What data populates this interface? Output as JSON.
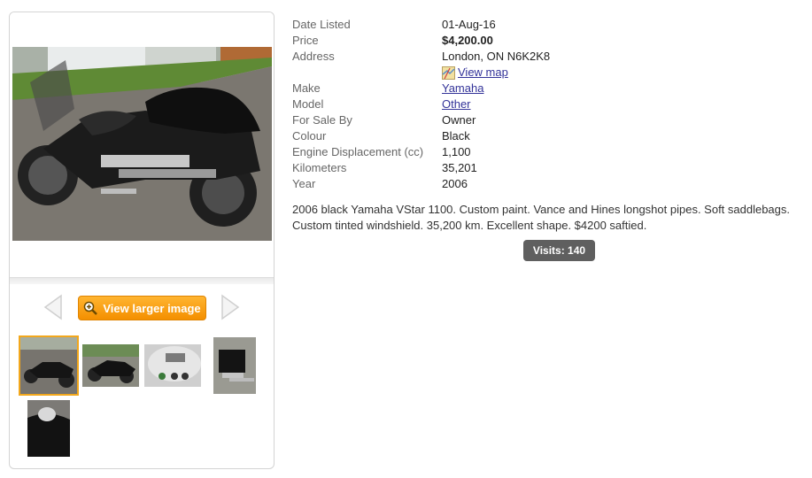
{
  "gallery": {
    "view_larger_label": "View larger image"
  },
  "details": {
    "rows": [
      {
        "label": "Date Listed",
        "value": "01-Aug-16"
      },
      {
        "label": "Price",
        "value": "$4,200.00"
      },
      {
        "label": "Address",
        "value": "London, ON N6K2K8",
        "link": "View map"
      },
      {
        "label": "Make",
        "value": "Yamaha"
      },
      {
        "label": "Model",
        "value": "Other"
      },
      {
        "label": "For Sale By",
        "value": "Owner"
      },
      {
        "label": "Colour",
        "value": "Black"
      },
      {
        "label": "Engine Displacement (cc)",
        "value": "1,100"
      },
      {
        "label": "Kilometers",
        "value": "35,201"
      },
      {
        "label": "Year",
        "value": "2006"
      }
    ]
  },
  "description": "2006 black Yamaha VStar 1100. Custom paint. Vance and Hines longshot pipes. Soft saddlebags. Custom tinted windshield. 35,200 km. Excellent shape. $4200 saftied.",
  "visits_label": "Visits: 140",
  "colors": {
    "accent": "#f48f00",
    "link": "#333399",
    "badge": "#5f5f5f"
  }
}
